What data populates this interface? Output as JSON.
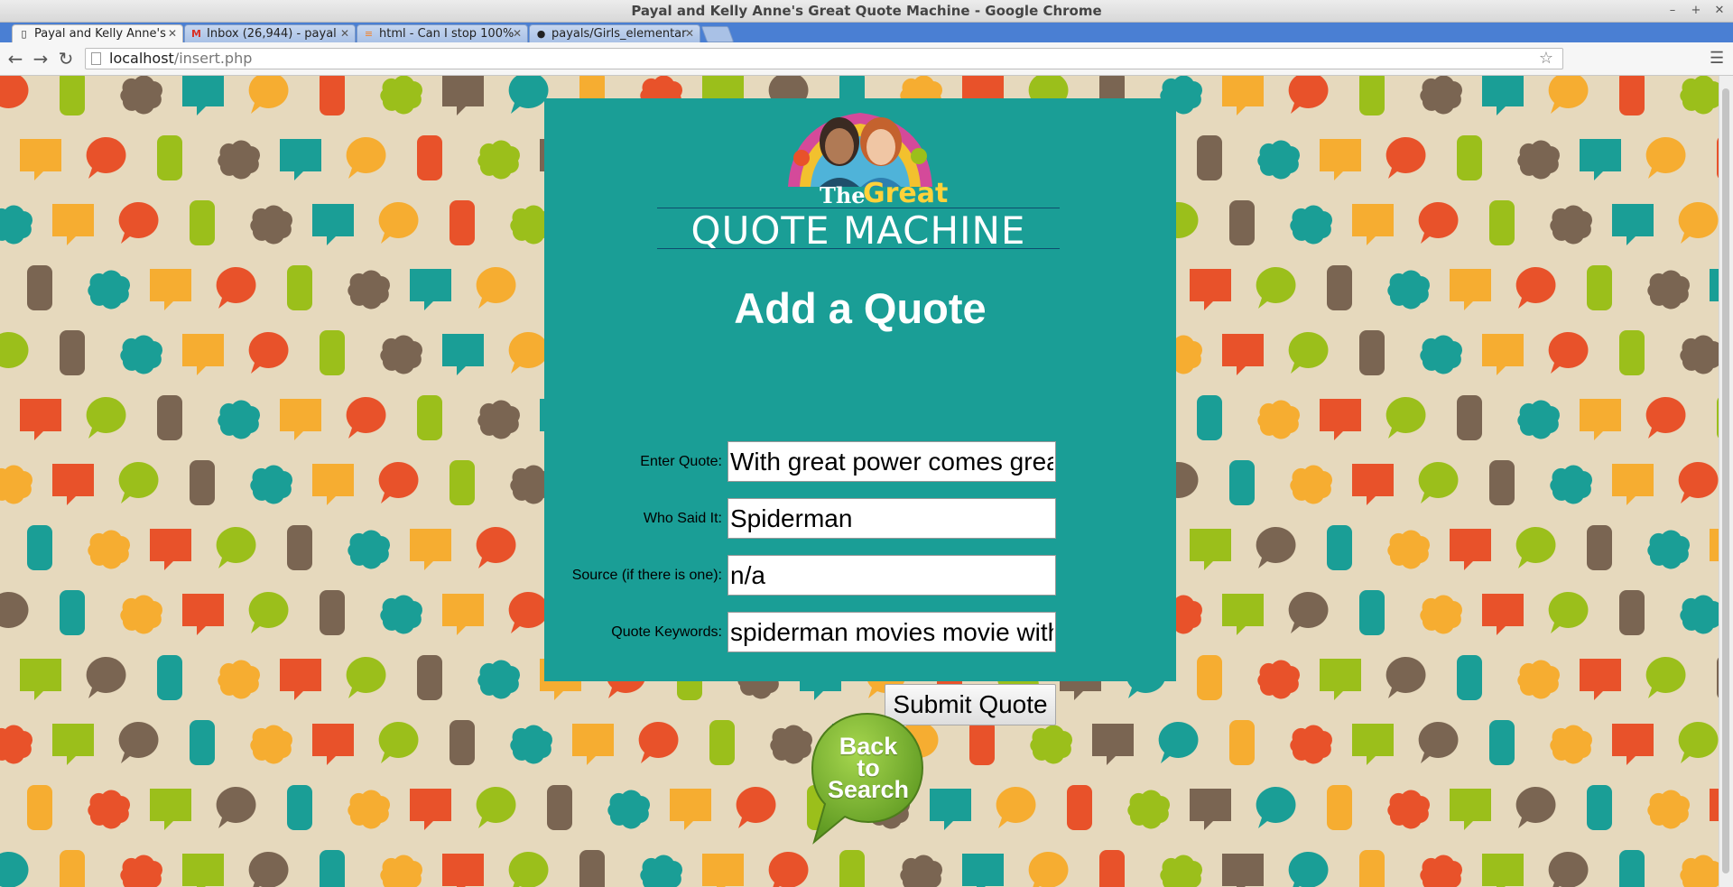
{
  "window": {
    "title": "Payal and Kelly Anne's Great Quote Machine - Google Chrome",
    "buttons": [
      "–",
      "+",
      "✕"
    ]
  },
  "tabs": [
    {
      "label": "Payal and Kelly Anne's",
      "icon": "page-icon",
      "active": true
    },
    {
      "label": "Inbox (26,944) - payal",
      "icon": "gmail-icon",
      "active": false
    },
    {
      "label": "html - Can I stop 100%",
      "icon": "stackoverflow-icon",
      "active": false
    },
    {
      "label": "payals/Girls_elementar",
      "icon": "github-icon",
      "active": false
    }
  ],
  "toolbar": {
    "url_host": "localhost",
    "url_path": "/insert.php"
  },
  "logo": {
    "the": "The",
    "great": "Great",
    "name": "QUOTE MACHINE"
  },
  "form": {
    "heading": "Add a Quote",
    "fields": [
      {
        "label": "Enter Quote:",
        "value": "With great power comes grea"
      },
      {
        "label": "Who Said It:",
        "value": "Spiderman"
      },
      {
        "label": "Source (if there is one):",
        "value": "n/a"
      },
      {
        "label": "Quote Keywords:",
        "value": "spiderman movies movie with"
      }
    ],
    "submit_label": "Submit Quote"
  },
  "back_button": {
    "lines": [
      "Back",
      "to",
      "Search"
    ]
  },
  "colors": {
    "panel": "#1a9e96",
    "background": "#e6d9bd",
    "bubble_orange": "#e8522a",
    "bubble_teal": "#1a9e96",
    "bubble_green": "#9bbf1b",
    "bubble_yellow": "#f6ad31",
    "bubble_brown": "#7a6552",
    "back_button": "#8cc43d"
  }
}
